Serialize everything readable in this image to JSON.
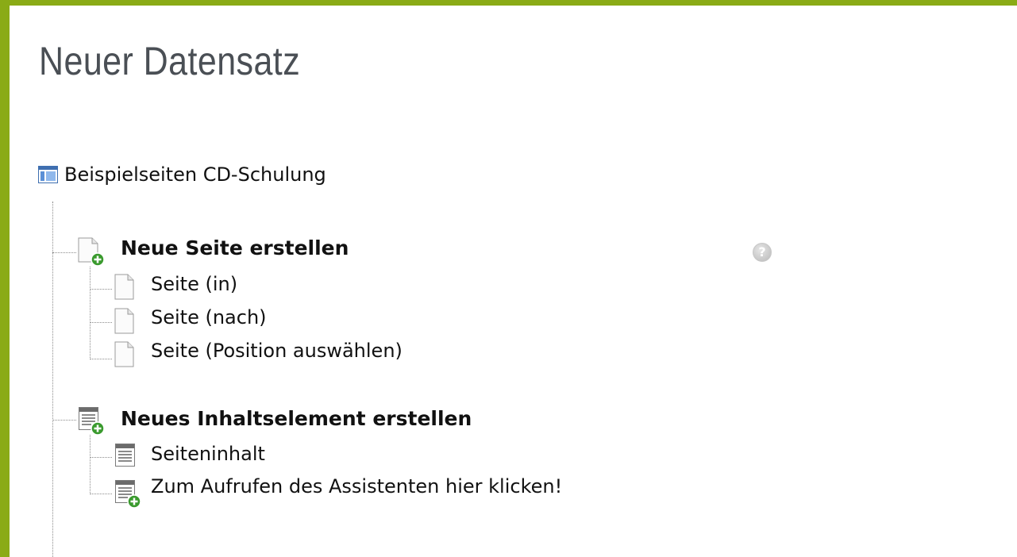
{
  "page": {
    "title": "Neuer Datensatz"
  },
  "tree": {
    "root": {
      "label": "Beispielseiten CD-Schulung",
      "icon": "page-tree-root-icon"
    },
    "groups": [
      {
        "heading": "Neue Seite erstellen",
        "icon": "new-page-icon",
        "items": [
          {
            "label": "Seite (in)",
            "icon": "page-icon"
          },
          {
            "label": "Seite (nach)",
            "icon": "page-icon"
          },
          {
            "label": "Seite (Position auswählen)",
            "icon": "page-icon"
          }
        ]
      },
      {
        "heading": "Neues Inhaltselement erstellen",
        "icon": "new-content-element-icon",
        "items": [
          {
            "label": "Seiteninhalt",
            "icon": "content-element-icon"
          },
          {
            "label": "Zum Aufrufen des Assistenten hier klicken!",
            "icon": "wizard-icon"
          }
        ]
      }
    ]
  },
  "help": {
    "glyph": "?",
    "icon": "help-icon"
  },
  "colors": {
    "accent": "#8aab16",
    "title": "#4a4f55",
    "plus": "#3a9a2e"
  }
}
